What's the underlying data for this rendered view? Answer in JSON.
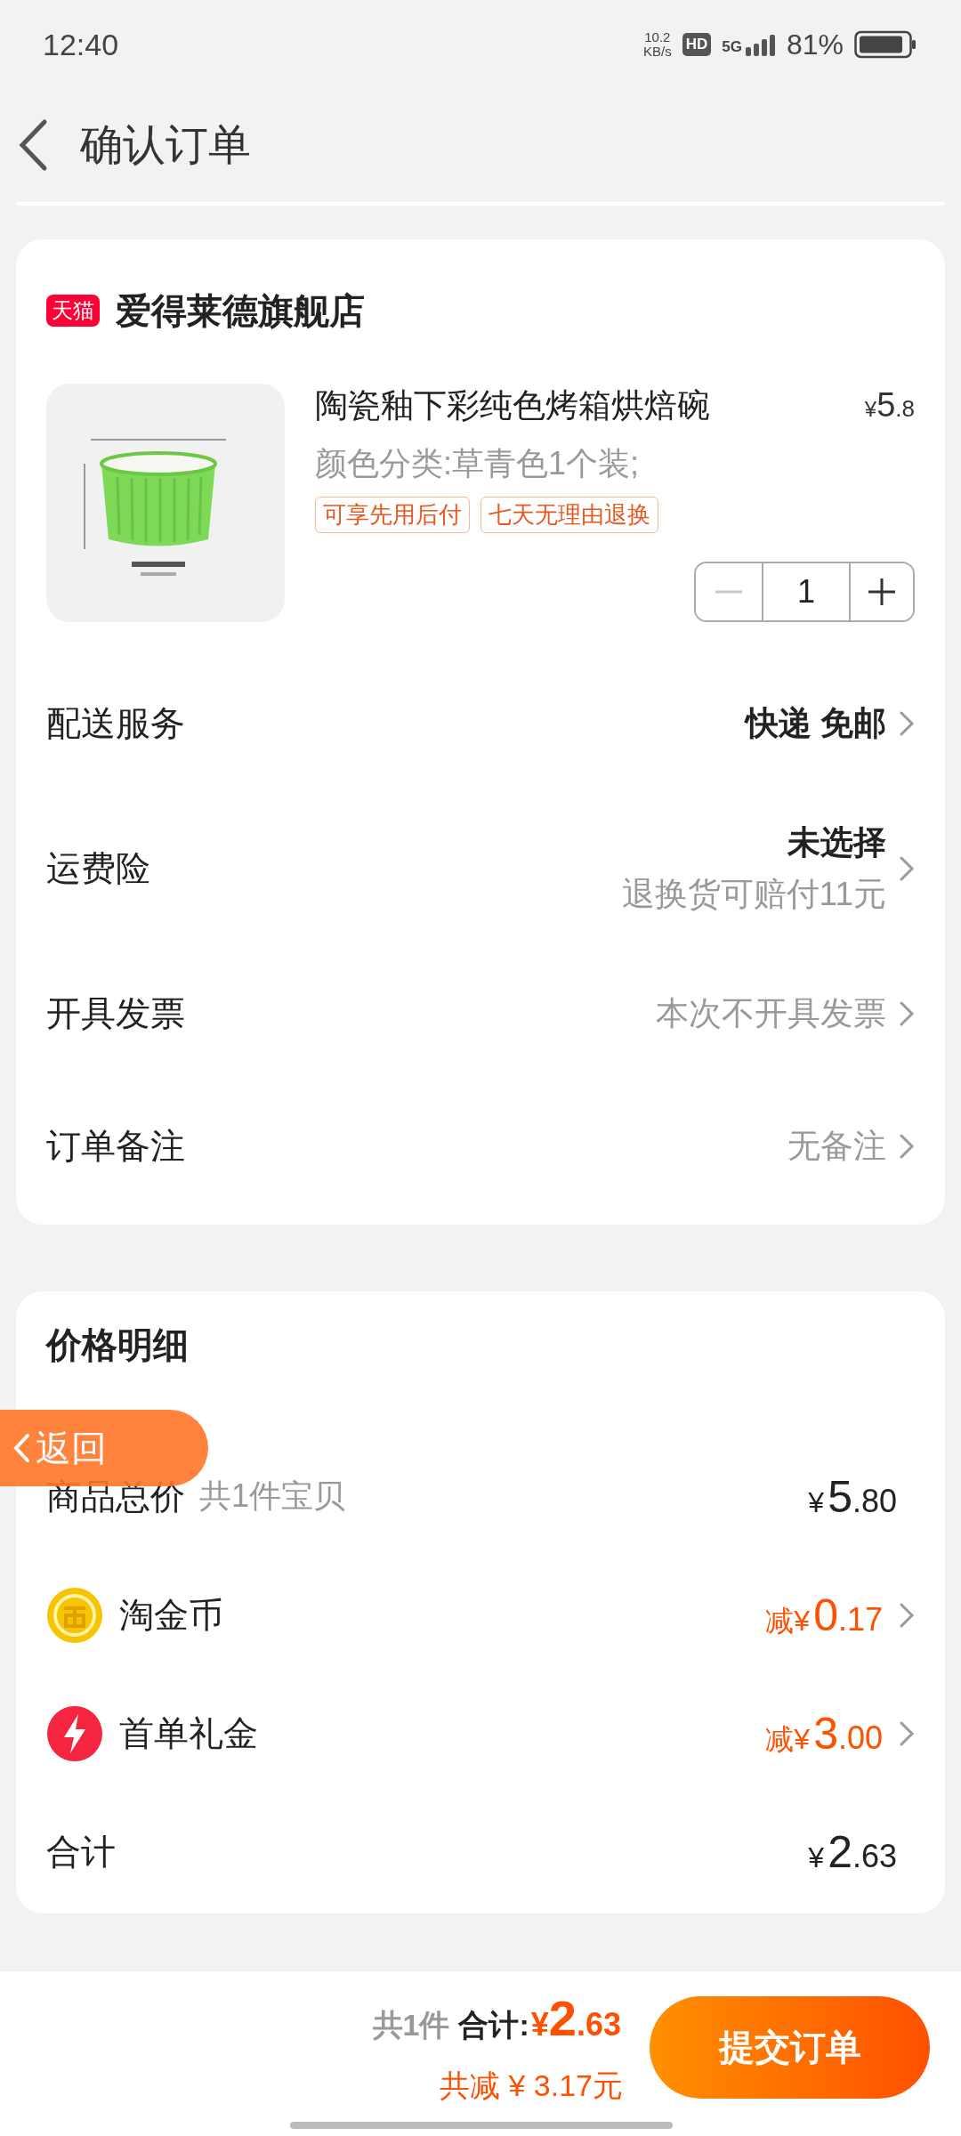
{
  "status_bar": {
    "time": "12:40",
    "net_speed": "10.2",
    "net_unit": "KB/s",
    "hd": "HD",
    "network": "5G",
    "battery": "81%"
  },
  "header": {
    "title": "确认订单"
  },
  "store": {
    "badge": "天猫",
    "name": "爱得莱德旗舰店"
  },
  "product": {
    "kind": "picture",
    "title": "陶瓷釉下彩纯色烤箱烘焙碗",
    "price_symbol": "¥",
    "price_int": "5",
    "price_dec": ".8",
    "spec": "颜色分类:草青色1个装;",
    "tags": [
      "可享先用后付",
      "七天无理由退换"
    ],
    "quantity": "1",
    "decrease_disabled": true
  },
  "services": [
    {
      "label": "配送服务",
      "value": "快递 免邮",
      "emphasis": true
    },
    {
      "label": "运费险",
      "value": "未选择",
      "note": "退换货可赔付11元",
      "emphasis": true
    },
    {
      "label": "开具发票",
      "value": "本次不开具发票",
      "emphasis": false
    },
    {
      "label": "订单备注",
      "value": "无备注",
      "emphasis": false
    }
  ],
  "price_detail": {
    "title": "价格明细",
    "rows": [
      {
        "kind": "total",
        "label": "商品总价",
        "sub": "共1件宝贝",
        "symbol": "¥",
        "int": "5",
        "dec": ".80"
      },
      {
        "kind": "coin",
        "label": "淘金币",
        "prefix": "减",
        "symbol": "¥",
        "int": "0",
        "dec": ".17"
      },
      {
        "kind": "bonus",
        "label": "首单礼金",
        "prefix": "减",
        "symbol": "¥",
        "int": "3",
        "dec": ".00"
      },
      {
        "kind": "sum",
        "label": "合计",
        "symbol": "¥",
        "int": "2",
        "dec": ".63"
      }
    ]
  },
  "float_back": {
    "label": "返回"
  },
  "footer": {
    "count": "共1件",
    "total_label": "合计:",
    "symbol": "¥",
    "int": "2",
    "dec": ".63",
    "saved": "共减 ¥ 3.17元",
    "submit": "提交订单"
  }
}
